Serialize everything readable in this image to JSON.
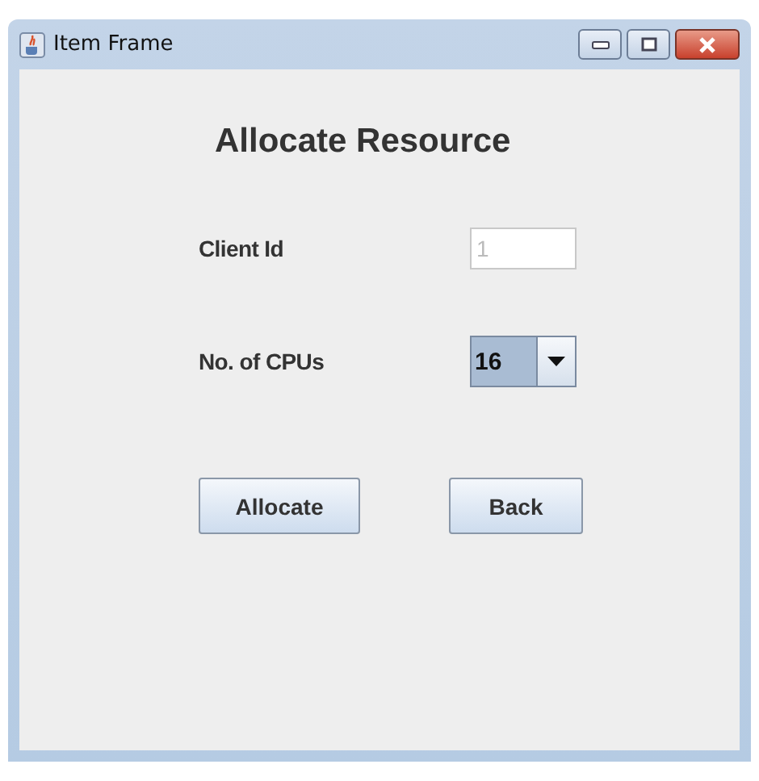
{
  "window": {
    "title": "Item Frame"
  },
  "heading": "Allocate Resource",
  "fields": [
    {
      "kind": "text",
      "label": "Client Id",
      "value": "1",
      "disabled": true
    },
    {
      "kind": "combo",
      "label": "No. of CPUs",
      "value": "16",
      "disabled": false
    }
  ],
  "buttons": [
    "Allocate",
    "Back"
  ]
}
